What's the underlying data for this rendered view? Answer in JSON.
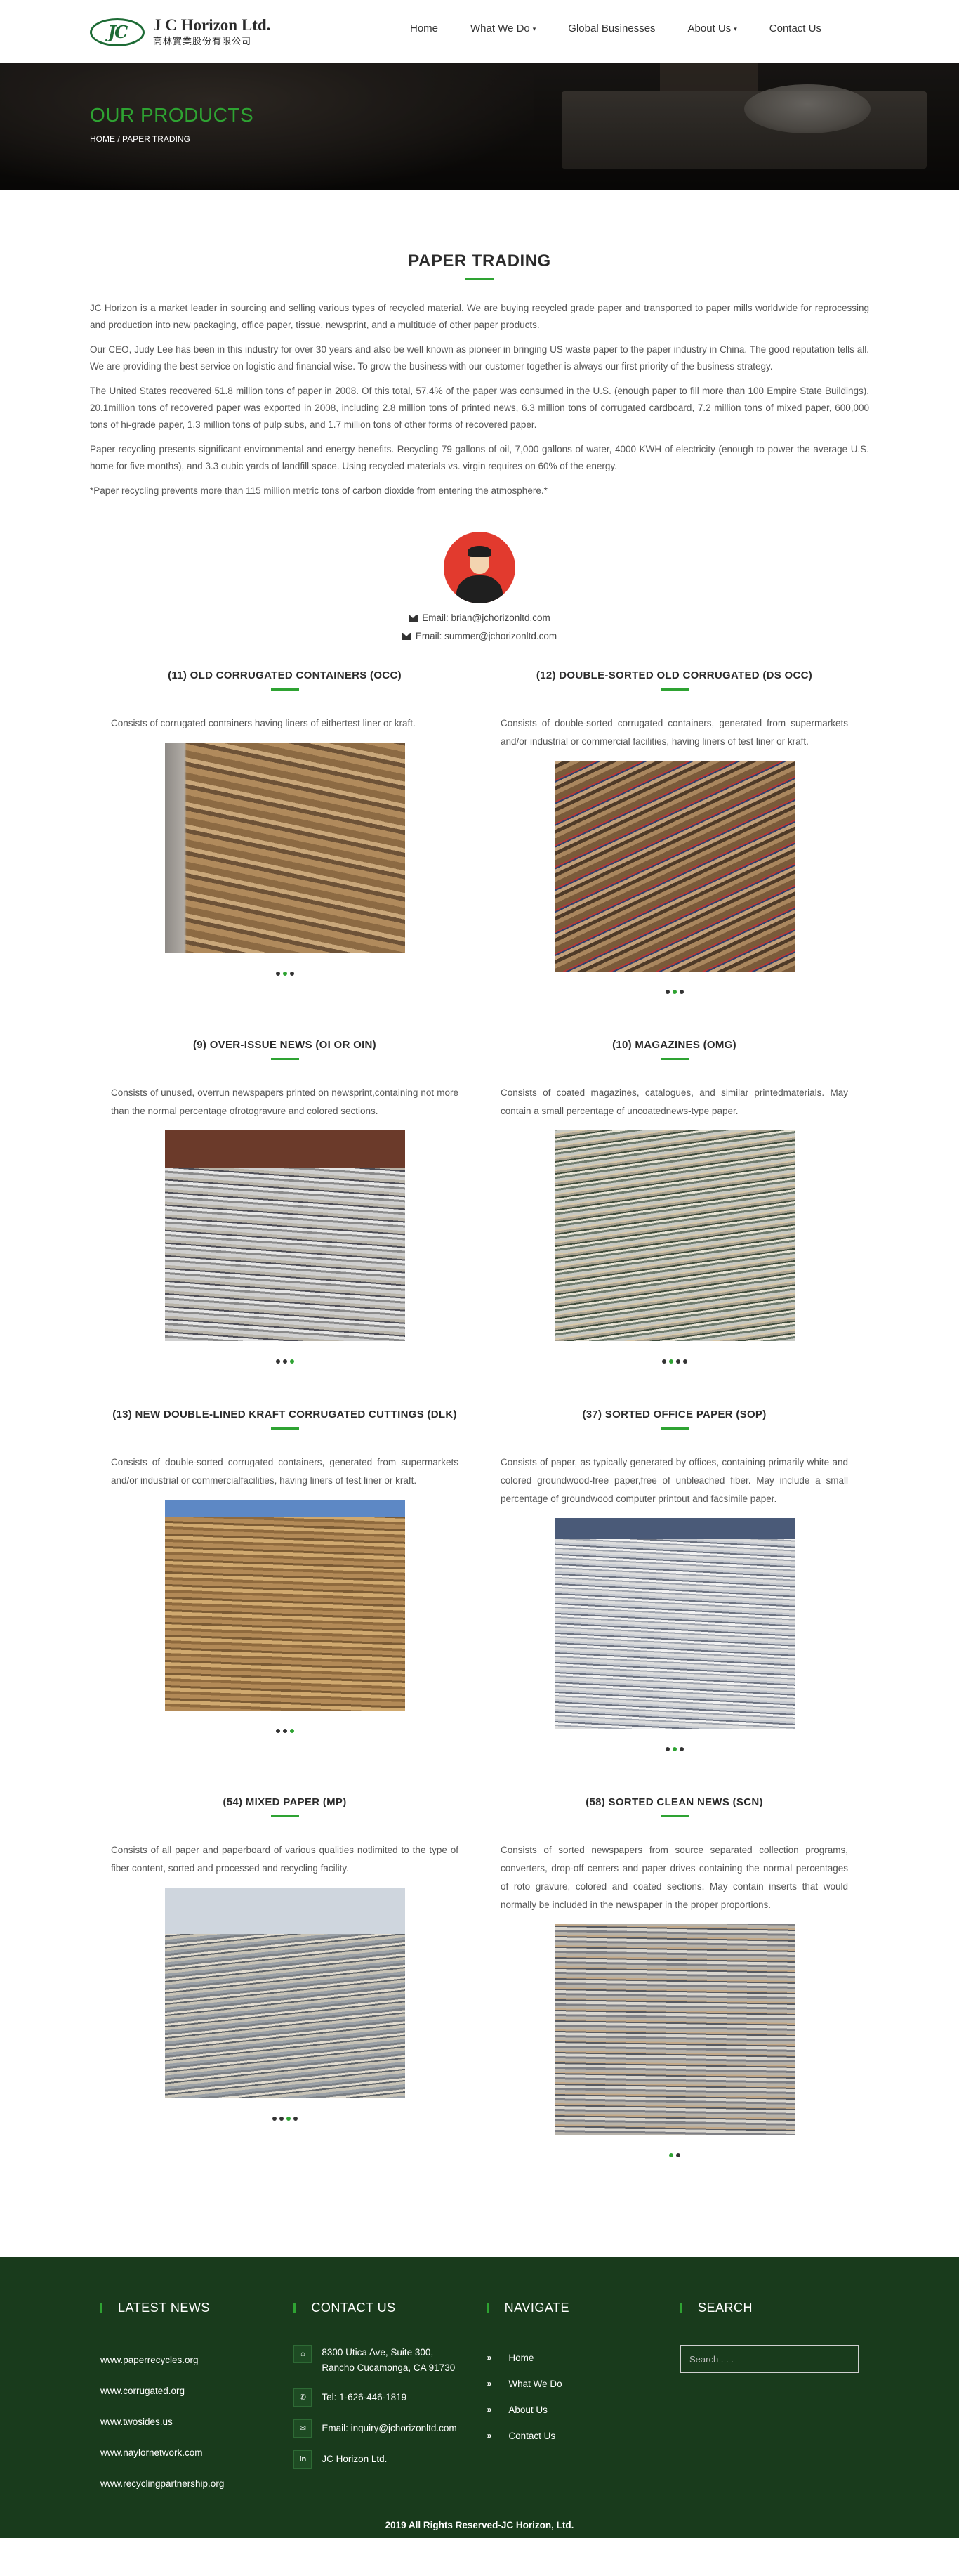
{
  "header": {
    "logo_mark": "JC",
    "logo_name": "J C Horizon Ltd.",
    "logo_cn": "高林實業股份有限公司",
    "nav": [
      {
        "label": "Home",
        "dropdown": false
      },
      {
        "label": "What We Do",
        "dropdown": true
      },
      {
        "label": "Global Businesses",
        "dropdown": false
      },
      {
        "label": "About Us",
        "dropdown": true
      },
      {
        "label": "Contact Us",
        "dropdown": false
      }
    ],
    "caret_glyph": "▾"
  },
  "banner": {
    "title": "OUR PRODUCTS",
    "breadcrumb": "HOME / PAPER TRADING"
  },
  "intro": {
    "title": "PAPER TRADING",
    "paragraphs": [
      "JC Horizon is a market leader in sourcing and selling various types of recycled material. We are buying recycled grade paper and transported to paper mills worldwide for reprocessing and production into new packaging, office paper, tissue, newsprint, and a multitude of other paper products.",
      "Our CEO, Judy Lee has been in this industry for over 30 years and also be well known as pioneer in bringing US waste paper to the paper industry in China. The good reputation tells all. We are providing the best service on logistic and financial wise. To grow the business with our customer together is always our first priority of the business strategy.",
      "The United States recovered 51.8 million tons of paper in 2008. Of this total, 57.4% of the paper was consumed in the U.S. (enough paper to fill more than 100 Empire State Buildings). 20.1million tons of recovered paper was exported in 2008, including 2.8 million tons of printed news, 6.3 million tons of corrugated cardboard, 7.2 million tons of mixed paper, 600,000 tons of hi-grade paper, 1.3 million tons of pulp subs, and 1.7 million tons of other forms of recovered paper.",
      "Paper recycling presents significant environmental and energy benefits. Recycling 79 gallons of oil, 7,000 gallons of water, 4000 KWH of electricity (enough to power the average U.S. home for five months), and 3.3 cubic yards of landfill space. Using recycled materials vs. virgin requires on 60% of the energy.",
      "*Paper recycling prevents more than 115 million metric tons of carbon dioxide from entering the atmosphere.*"
    ]
  },
  "contact": {
    "emails": [
      "Email: brian@jchorizonltd.com",
      "Email: summer@jchorizonltd.com"
    ]
  },
  "products": [
    {
      "title": "(11) OLD CORRUGATED CONTAINERS (OCC)",
      "desc": "Consists of corrugated containers having liners of eithertest liner or kraft.",
      "img": "img-occ",
      "dots": [
        false,
        true,
        false
      ]
    },
    {
      "title": "(12) DOUBLE-SORTED OLD CORRUGATED (DS OCC)",
      "desc": "Consists of double-sorted corrugated containers, generated from supermarkets and/or industrial or commercial facilities, having liners of test liner or kraft.",
      "img": "img-dsocc",
      "dots": [
        false,
        true,
        false
      ]
    },
    {
      "title": "(9) OVER-ISSUE NEWS (OI OR OIN)",
      "desc": "Consists of unused, overrun newspapers printed on newsprint,containing not more than the normal percentage ofrotogravure and colored sections.",
      "img": "img-news",
      "dots": [
        false,
        false,
        true
      ]
    },
    {
      "title": "(10) MAGAZINES (OMG)",
      "desc": "Consists of coated magazines, catalogues, and similar printedmaterials. May contain a small percentage of uncoatednews-type paper.",
      "img": "img-omg",
      "dots": [
        false,
        true,
        false,
        false
      ]
    },
    {
      "title": "(13) NEW DOUBLE-LINED KRAFT CORRUGATED CUTTINGS (DLK)",
      "desc": "Consists of double-sorted corrugated containers, generated from supermarkets and/or industrial or commercialfacilities, having liners of test liner or kraft.",
      "img": "img-dlk",
      "dots": [
        false,
        false,
        true
      ]
    },
    {
      "title": "(37) SORTED OFFICE PAPER (SOP)",
      "desc": "Consists of paper, as typically generated by offices, containing primarily white and colored groundwood-free paper,free of unbleached fiber. May include a small percentage of groundwood computer printout and facsimile paper.",
      "img": "img-sop",
      "dots": [
        false,
        true,
        false
      ]
    },
    {
      "title": "(54) MIXED PAPER (MP)",
      "desc": "Consists of all paper and paperboard of various qualities notlimited to the type of fiber content, sorted and processed and recycling facility.",
      "img": "img-mp",
      "dots": [
        false,
        false,
        true,
        false
      ]
    },
    {
      "title": "(58) SORTED CLEAN NEWS (SCN)",
      "desc": "Consists of sorted newspapers from source separated collection programs, converters, drop-off centers and paper drives containing the normal percentages of roto gravure, colored and coated sections. May contain inserts that would normally be included in the newspaper in the proper proportions.",
      "img": "img-scn",
      "dots": [
        true,
        false
      ]
    }
  ],
  "footer": {
    "news": {
      "title": "LATEST NEWS",
      "links": [
        "www.paperrecycles.org",
        "www.corrugated.org",
        "www.twosides.us",
        "www.naylornetwork.com",
        "www.recyclingpartnership.org"
      ]
    },
    "contact": {
      "title": "CONTACT US",
      "address": [
        "8300 Utica Ave, Suite 300,",
        "Rancho Cucamonga, CA 91730"
      ],
      "tel": "Tel: 1-626-446-1819",
      "email": "Email: inquiry@jchorizonltd.com",
      "linkedin": "JC Horizon Ltd."
    },
    "navigate": {
      "title": "NAVIGATE",
      "items": [
        "Home",
        "What We Do",
        "About Us",
        "Contact Us"
      ]
    },
    "search": {
      "title": "SEARCH",
      "placeholder": "Search . . ."
    },
    "copyright": "2019 All Rights Reserved-JC Horizon, Ltd."
  },
  "colors": {
    "accent": "#2ea332",
    "footer_bg": "#193b1c",
    "avatar_bg": "#e23a2e"
  }
}
